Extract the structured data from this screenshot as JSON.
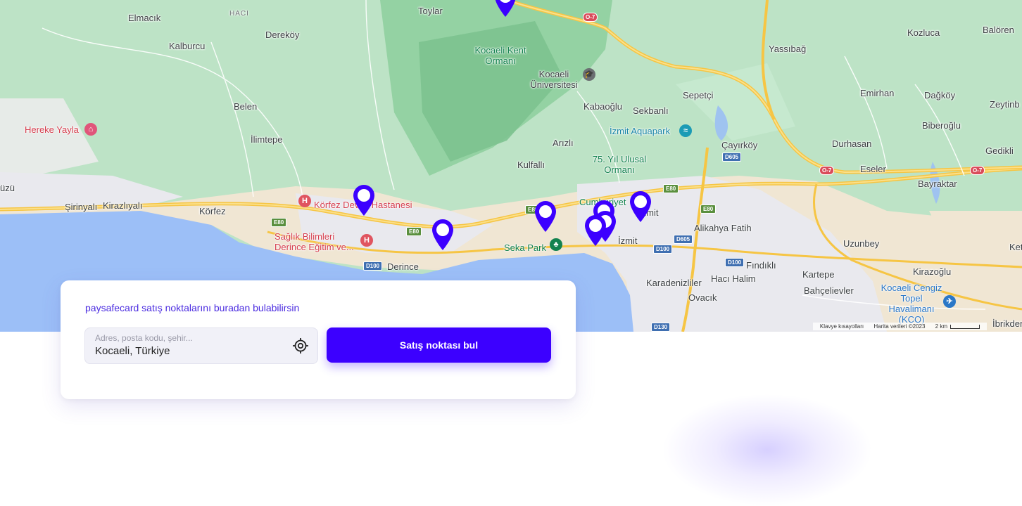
{
  "map": {
    "places": {
      "toylar": "Toylar",
      "elmacik": "Elmacık",
      "haci": "HACI",
      "derekoy": "Dereköy",
      "kalburcu": "Kalburcu",
      "kocaeli_kent_ormani": "Kocaeli Kent Ormanı",
      "kocaeli_universitesi": "Kocaeli Üniversitesi",
      "belen": "Belen",
      "kabaoglu": "Kabaoğlu",
      "sekbanli": "Sekbanlı",
      "sepetci": "Sepetçi",
      "yassibag": "Yassıbağ",
      "kozluca": "Kozluca",
      "baloren": "Balören",
      "emirhan": "Emirhan",
      "dagkoy": "Dağköy",
      "zeytinburnu": "Zeytinb",
      "hereke_yayla": "Hereke Yayla",
      "ilimtepe": "İlimtepe",
      "arizli": "Arızlı",
      "izmit_aquapark": "İzmit Aquapark",
      "cayirkoy": "Çayırköy",
      "biberoglu": "Biberoğlu",
      "durhasan": "Durhasan",
      "gedikli": "Gedikli",
      "kulfalli": "Kulfallı",
      "yil_ulusal_ormani": "75. Yıl Ulusal Ormanı",
      "eseler": "Eseler",
      "bayraktar": "Bayraktar",
      "uzu": "üzü",
      "sirinyali": "Şirinyalı",
      "kirazliyali": "Kirazlıyalı",
      "korfez": "Körfez",
      "korfez_devlet": "Körfez Devlet Hastanesi",
      "cumhuriyet": "Cumhuriyet",
      "izmit_top": "İzmit",
      "alikahya": "Alikahya Fatih",
      "saglik": "Sağlık Bilimleri Derince Eğitim ve...",
      "seka_park": "Seka Park",
      "izmit": "İzmit",
      "uzunbey": "Uzunbey",
      "ket": "Ket",
      "derince": "Derince",
      "findikli": "Fındıklı",
      "kartepe": "Kartepe",
      "kirazoglu": "Kirazoğlu",
      "karadenizliler": "Karadenizliler",
      "haci_halim": "Hacı Halim",
      "bahcelievler": "Bahçelievler",
      "ovacik": "Ovacık",
      "havalimani": "Kocaeli Cengiz Topel Havalimanı (KCO)",
      "ibrikdere": "İbrikdere"
    },
    "shields": {
      "o7_a": "O-7",
      "o7_b": "O-7",
      "o7_c": "O-7",
      "e80_a": "E80",
      "e80_b": "E80",
      "e80_c": "E80",
      "e80_d": "E80",
      "e80_e": "E80",
      "d605_a": "D605",
      "d605_b": "D605",
      "d100_a": "D100",
      "d100_b": "D100",
      "d100_c": "D100",
      "d130": "D130"
    },
    "attribution": {
      "shortcuts": "Klavye kısayolları",
      "data": "Harita verileri ©2023",
      "scale": "2 km"
    },
    "marker_color": "#3c00ff",
    "marker_count": 8
  },
  "card": {
    "tagline": "paysafecard satış noktalarını buradan bulabilirsin",
    "search": {
      "placeholder": "Adres, posta kodu, şehir...",
      "value": "Kocaeli, Türkiye"
    },
    "button_label": "Satış noktası bul",
    "accent": "#3c00ff"
  },
  "icons": {
    "locate": "crosshair-locate-icon",
    "hospital": "hospital-icon",
    "park": "tree-icon",
    "hotel": "bed-icon",
    "university": "graduation-cap-icon",
    "water_park": "water-park-icon",
    "airport": "airplane-icon",
    "marker": "map-pin-icon"
  }
}
